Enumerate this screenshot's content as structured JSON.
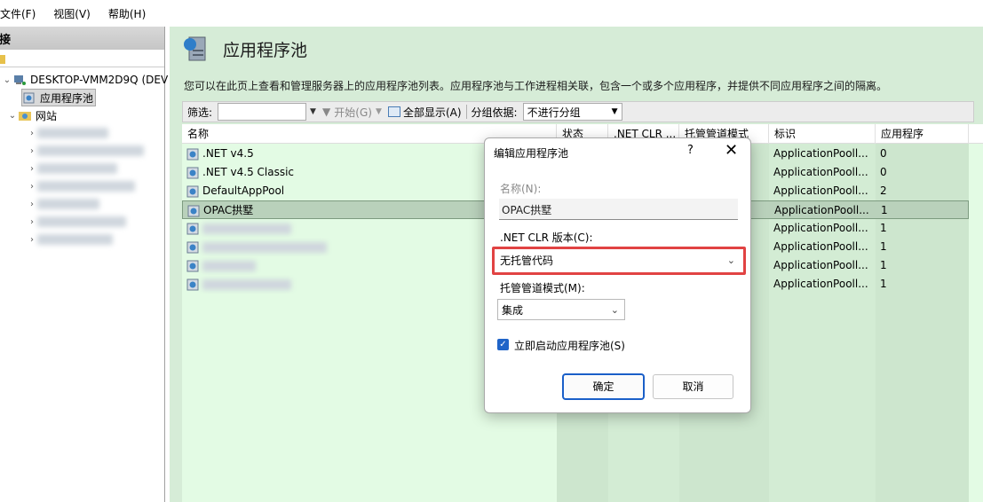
{
  "menu": {
    "file": "文件(F)",
    "view": "视图(V)",
    "help": "帮助(H)"
  },
  "left_panel": {
    "header": "连接",
    "tree": {
      "server": "DESKTOP-VMM2D9Q (DEV",
      "app_pools": "应用程序池",
      "sites": "网站"
    }
  },
  "page": {
    "title": "应用程序池",
    "description": "您可以在此页上查看和管理服务器上的应用程序池列表。应用程序池与工作进程相关联，包含一个或多个应用程序，并提供不同应用程序之间的隔离。"
  },
  "filter_bar": {
    "filter_label": "筛选:",
    "go_label": "开始(G)",
    "show_all_label": "全部显示(A)",
    "group_by_label": "分组依据:",
    "group_by_value": "不进行分组"
  },
  "table": {
    "columns": {
      "name": "名称",
      "status": "状态",
      "clr": ".NET CLR ...",
      "pipeline": "托管管道模式",
      "identity": "标识",
      "apps": "应用程序"
    },
    "rows": [
      {
        "name": ".NET v4.5",
        "identity": "ApplicationPooll...",
        "apps": "0"
      },
      {
        "name": ".NET v4.5 Classic",
        "identity": "ApplicationPooll...",
        "apps": "0"
      },
      {
        "name": "DefaultAppPool",
        "identity": "ApplicationPooll...",
        "apps": "2"
      },
      {
        "name": "OPAC拱墅",
        "identity": "ApplicationPooll...",
        "apps": "1"
      },
      {
        "name": "",
        "identity": "ApplicationPooll...",
        "apps": "1"
      },
      {
        "name": "",
        "identity": "ApplicationPooll...",
        "apps": "1"
      },
      {
        "name": "",
        "identity": "ApplicationPooll...",
        "apps": "1"
      },
      {
        "name": "",
        "identity": "ApplicationPooll...",
        "apps": "1"
      }
    ],
    "selected_row": 3
  },
  "dialog": {
    "title": "编辑应用程序池",
    "help": "?",
    "close": "✕",
    "name_label": "名称(N):",
    "name_value": "OPAC拱墅",
    "clr_label": ".NET CLR 版本(C):",
    "clr_value": "无托管代码",
    "pipeline_label": "托管管道模式(M):",
    "pipeline_value": "集成",
    "start_label": "立即启动应用程序池(S)",
    "start_checked": true,
    "ok": "确定",
    "cancel": "取消"
  },
  "colors": {
    "content_bg": "#d6ecd7",
    "table_bg": "#e3fbe4",
    "highlight": "#e14343",
    "accent": "#1a5fc8"
  }
}
